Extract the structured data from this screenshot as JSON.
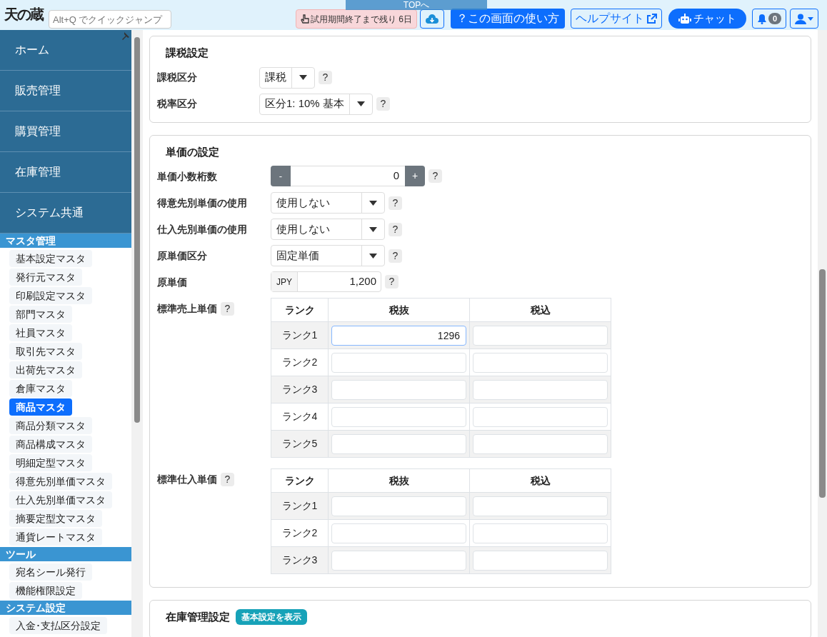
{
  "header": {
    "logo": "天の蔵",
    "search": {
      "placeholder": "Alt+Q でクイックジャンプ"
    },
    "trial_notice": "試用期間終了まで残り 6日",
    "top_button": "TOPへ",
    "help_button": "？この画面の使い方",
    "help_site": "ヘルプサイト",
    "chat": "チャット",
    "notifications": "0"
  },
  "sidebar": {
    "main_items": [
      "ホーム",
      "販売管理",
      "購買管理",
      "在庫管理",
      "システム共通"
    ],
    "sections": [
      {
        "title": "マスタ管理",
        "items": [
          {
            "label": "基本設定マスタ",
            "selected": false
          },
          {
            "label": "発行元マスタ",
            "selected": false
          },
          {
            "label": "印刷設定マスタ",
            "selected": false
          },
          {
            "label": "部門マスタ",
            "selected": false
          },
          {
            "label": "社員マスタ",
            "selected": false
          },
          {
            "label": "取引先マスタ",
            "selected": false
          },
          {
            "label": "出荷先マスタ",
            "selected": false
          },
          {
            "label": "倉庫マスタ",
            "selected": false
          },
          {
            "label": "商品マスタ",
            "selected": true
          },
          {
            "label": "商品分類マスタ",
            "selected": false
          },
          {
            "label": "商品構成マスタ",
            "selected": false
          },
          {
            "label": "明細定型マスタ",
            "selected": false
          },
          {
            "label": "得意先別単価マスタ",
            "selected": false
          },
          {
            "label": "仕入先別単価マスタ",
            "selected": false
          },
          {
            "label": "摘要定型文マスタ",
            "selected": false
          },
          {
            "label": "通貨レートマスタ",
            "selected": false
          }
        ]
      },
      {
        "title": "ツール",
        "items": [
          {
            "label": "宛名シール発行",
            "selected": false
          },
          {
            "label": "機能権限設定",
            "selected": false
          }
        ]
      },
      {
        "title": "システム設定",
        "items": [
          {
            "label": "入金･支払区分設定",
            "selected": false
          }
        ]
      }
    ]
  },
  "cards": [
    {
      "title": "課税設定",
      "fields": [
        {
          "kind": "select",
          "label": "課税区分",
          "value": "課税",
          "help": "?"
        },
        {
          "kind": "select",
          "label": "税率区分",
          "value": "区分1: 10% 基本",
          "help": "?"
        }
      ]
    },
    {
      "title": "単価の設定",
      "fields": [
        {
          "kind": "stepper",
          "label": "単価小数桁数",
          "minus": "-",
          "value": "0",
          "plus": "+",
          "help": "?"
        },
        {
          "kind": "select",
          "label": "得意先別単価の使用",
          "value": "使用しない",
          "help": "?"
        },
        {
          "kind": "select",
          "label": "仕入先別単価の使用",
          "value": "使用しない",
          "help": "?"
        },
        {
          "kind": "select",
          "label": "原単価区分",
          "value": "固定単価",
          "help": "?"
        },
        {
          "kind": "currency",
          "label": "原単価",
          "currency": "JPY",
          "value": "1,200",
          "help": "?"
        },
        {
          "kind": "table",
          "label": "標準売上単価",
          "help": "?",
          "columns": [
            "ランク",
            "税抜",
            "税込"
          ],
          "rows": [
            {
              "rank": "ランク1",
              "excl": "1296",
              "focused": true
            },
            {
              "rank": "ランク2",
              "excl": "",
              "focused": false
            },
            {
              "rank": "ランク3",
              "excl": "",
              "focused": false
            },
            {
              "rank": "ランク4",
              "excl": "",
              "focused": false
            },
            {
              "rank": "ランク5",
              "excl": "",
              "focused": false
            }
          ]
        },
        {
          "kind": "table",
          "label": "標準仕入単価",
          "help": "?",
          "columns": [
            "ランク",
            "税抜",
            "税込"
          ],
          "rows": [
            {
              "rank": "ランク1",
              "excl": "",
              "focused": false
            },
            {
              "rank": "ランク2",
              "excl": "",
              "focused": false
            },
            {
              "rank": "ランク3",
              "excl": "",
              "focused": false
            }
          ]
        }
      ]
    },
    {
      "title": "在庫管理設定",
      "badge": "基本設定を表示"
    }
  ]
}
